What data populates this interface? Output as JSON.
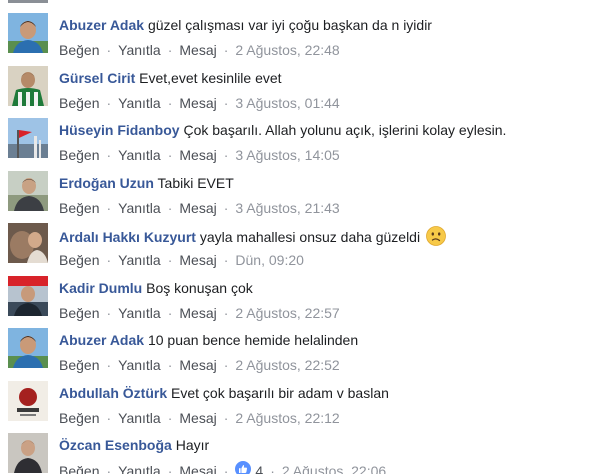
{
  "actions": {
    "like": "Beğen",
    "reply": "Yanıtla",
    "message": "Mesaj",
    "separator": "·"
  },
  "comments": [
    {
      "author": "Abuzer Adak",
      "text": "güzel çalışması var iyi çoğu başkan da n iyidir",
      "time": "2 Ağustos, 22:48"
    },
    {
      "author": "Gürsel Cirit",
      "text": "Evet,evet kesinlile evet",
      "time": "3 Ağustos, 01:44"
    },
    {
      "author": "Hüseyin Fidanboy",
      "text": "Çok başarılı. Allah yolunu açık, işlerini kolay eylesin.",
      "time": "3 Ağustos, 14:05"
    },
    {
      "author": "Erdoğan Uzun",
      "text": "Tabiki EVET",
      "time": "3 Ağustos, 21:43"
    },
    {
      "author": "Ardalı Hakkı Kuzyurt",
      "text": "yayla mahallesi onsuz daha güzeldi",
      "time": "Dün, 09:20",
      "emoji": "confused-face-icon"
    },
    {
      "author": "Kadir Dumlu",
      "text": "Boş konuşan çok",
      "time": "2 Ağustos, 22:57"
    },
    {
      "author": "Abuzer Adak",
      "text": "10 puan bence hemide helalinden",
      "time": "2 Ağustos, 22:52"
    },
    {
      "author": "Abdullah Öztürk",
      "text": "Evet çok başarılı bir adam v baslan",
      "time": "2 Ağustos, 22:12"
    },
    {
      "author": "Özcan Esenboğa",
      "text": "Hayır",
      "time": "2 Ağustos, 22:06",
      "reactions": {
        "icon": "like-thumb-icon",
        "count": "4"
      }
    }
  ],
  "colors": {
    "author": "#385898",
    "text": "#1c1e21",
    "action": "#4b4f56",
    "meta": "#90949c",
    "like_badge": "#5890ff"
  }
}
